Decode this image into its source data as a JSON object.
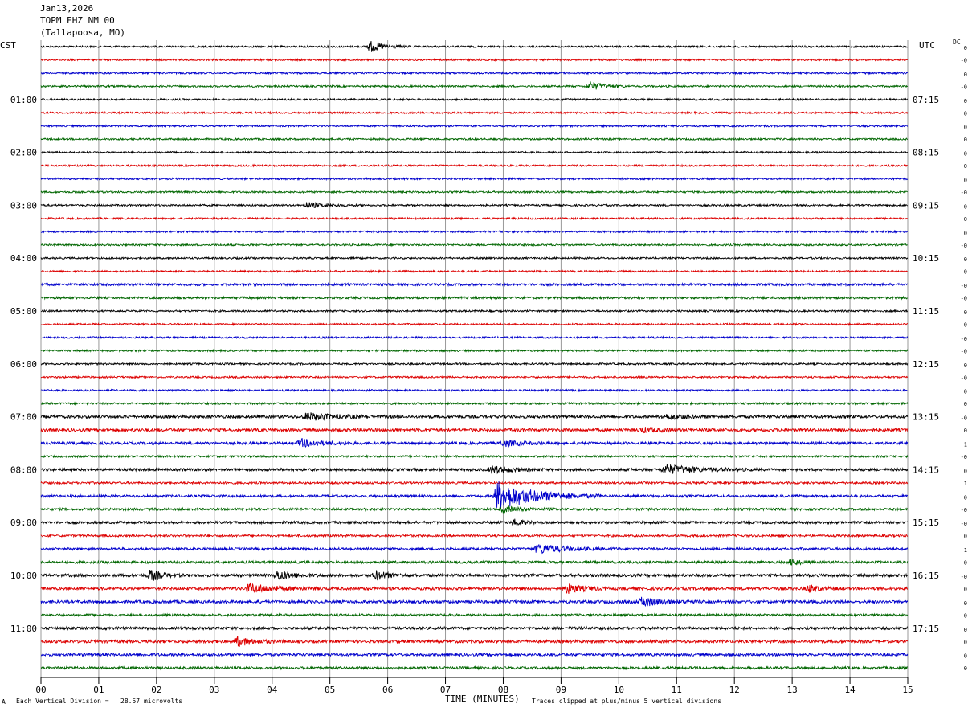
{
  "header": {
    "date": "Jan13,2026",
    "station": "TOPM EHZ NM 00",
    "location": "(Tallapoosa, MO)"
  },
  "left_zone_label": "CST",
  "right_zone_label": "UTC",
  "dc_label": "DC",
  "footer": {
    "scale_text": "Each Vertical Division =   28.57 microvolts",
    "xlabel": "TIME (MINUTES)",
    "clip_text": "Traces clipped at plus/minus 5 vertical divisions",
    "mark": "A"
  },
  "colors": {
    "trace_cycle": [
      "#000000",
      "#dd0000",
      "#0000cc",
      "#006600"
    ],
    "grid": "#999999"
  },
  "chart_data": {
    "type": "line",
    "title": "Jan13,2026 TOPM EHZ NM 00 (Tallapoosa, MO)",
    "xlabel": "TIME (MINUTES)",
    "xlim": [
      0,
      15
    ],
    "x_ticks": [
      "00",
      "01",
      "02",
      "03",
      "04",
      "05",
      "06",
      "07",
      "08",
      "09",
      "10",
      "11",
      "12",
      "13",
      "14",
      "15"
    ],
    "trace_count": 48,
    "left_hour_labels": [
      {
        "trace": 4,
        "label": "01:00"
      },
      {
        "trace": 8,
        "label": "02:00"
      },
      {
        "trace": 12,
        "label": "03:00"
      },
      {
        "trace": 16,
        "label": "04:00"
      },
      {
        "trace": 20,
        "label": "05:00"
      },
      {
        "trace": 24,
        "label": "06:00"
      },
      {
        "trace": 28,
        "label": "07:00"
      },
      {
        "trace": 32,
        "label": "08:00"
      },
      {
        "trace": 36,
        "label": "09:00"
      },
      {
        "trace": 40,
        "label": "10:00"
      },
      {
        "trace": 44,
        "label": "11:00"
      }
    ],
    "right_hour_labels": [
      {
        "trace": 4,
        "label": "07:15"
      },
      {
        "trace": 8,
        "label": "08:15"
      },
      {
        "trace": 12,
        "label": "09:15"
      },
      {
        "trace": 16,
        "label": "10:15"
      },
      {
        "trace": 20,
        "label": "11:15"
      },
      {
        "trace": 24,
        "label": "12:15"
      },
      {
        "trace": 28,
        "label": "13:15"
      },
      {
        "trace": 32,
        "label": "14:15"
      },
      {
        "trace": 36,
        "label": "15:15"
      },
      {
        "trace": 40,
        "label": "16:15"
      },
      {
        "trace": 44,
        "label": "17:15"
      }
    ],
    "dc_offsets": [
      "0",
      "-0",
      "0",
      "-0",
      "0",
      "0",
      "0",
      "0",
      "0",
      "0",
      "0",
      "-0",
      "0",
      "0",
      "0",
      "-0",
      "0",
      "0",
      "-0",
      "-0",
      "0",
      "0",
      "-0",
      "-0",
      "0",
      "-0",
      "0",
      "0",
      "-0",
      "0",
      "1",
      "-0",
      "0",
      "1",
      "0",
      "-0",
      "-0",
      "0",
      "1",
      "0",
      "-0",
      "0",
      "0",
      "-0",
      "0",
      "0",
      "0",
      "0"
    ],
    "noise_levels": [
      1,
      1,
      1,
      1,
      1,
      1,
      1,
      1,
      1,
      1,
      1,
      1,
      1,
      1,
      1,
      1,
      1,
      1,
      1.3,
      1.3,
      1,
      1,
      1,
      1,
      1,
      1,
      1,
      1.1,
      1.6,
      1.7,
      1.5,
      1.1,
      1.5,
      1.2,
      1.4,
      1.3,
      1.4,
      1.2,
      1.4,
      1.4,
      1.6,
      1.6,
      1.6,
      1.3,
      1.5,
      1.6,
      1.5,
      1.4
    ],
    "events": [
      {
        "trace": 0,
        "minute": 5.7,
        "amplitude": 3,
        "duration": 0.7
      },
      {
        "trace": 3,
        "minute": 9.5,
        "amplitude": 2.5,
        "duration": 0.7
      },
      {
        "trace": 12,
        "minute": 4.6,
        "amplitude": 1.5,
        "duration": 1.0
      },
      {
        "trace": 28,
        "minute": 4.6,
        "amplitude": 2,
        "duration": 1.5
      },
      {
        "trace": 28,
        "minute": 10.8,
        "amplitude": 1.5,
        "duration": 1.0
      },
      {
        "trace": 29,
        "minute": 10.4,
        "amplitude": 1.3,
        "duration": 0.7
      },
      {
        "trace": 30,
        "minute": 4.5,
        "amplitude": 2,
        "duration": 1.0
      },
      {
        "trace": 30,
        "minute": 8.0,
        "amplitude": 1.5,
        "duration": 1.0
      },
      {
        "trace": 32,
        "minute": 7.8,
        "amplitude": 1.8,
        "duration": 1.0
      },
      {
        "trace": 32,
        "minute": 10.8,
        "amplitude": 2.5,
        "duration": 1.6
      },
      {
        "trace": 34,
        "minute": 7.9,
        "amplitude": 8,
        "duration": 1.8
      },
      {
        "trace": 35,
        "minute": 8.0,
        "amplitude": 1.5,
        "duration": 1.0
      },
      {
        "trace": 36,
        "minute": 8.2,
        "amplitude": 2,
        "duration": 0.4
      },
      {
        "trace": 38,
        "minute": 8.6,
        "amplitude": 2.5,
        "duration": 1.4
      },
      {
        "trace": 39,
        "minute": 13.0,
        "amplitude": 2,
        "duration": 0.4
      },
      {
        "trace": 40,
        "minute": 1.9,
        "amplitude": 3,
        "duration": 0.6
      },
      {
        "trace": 40,
        "minute": 4.1,
        "amplitude": 2.5,
        "duration": 0.8
      },
      {
        "trace": 40,
        "minute": 5.8,
        "amplitude": 2.5,
        "duration": 0.6
      },
      {
        "trace": 41,
        "minute": 3.6,
        "amplitude": 2.5,
        "duration": 1.3
      },
      {
        "trace": 41,
        "minute": 9.1,
        "amplitude": 2.5,
        "duration": 0.8
      },
      {
        "trace": 41,
        "minute": 13.3,
        "amplitude": 2,
        "duration": 0.5
      },
      {
        "trace": 42,
        "minute": 10.4,
        "amplitude": 2.5,
        "duration": 1.0
      },
      {
        "trace": 45,
        "minute": 3.4,
        "amplitude": 2.5,
        "duration": 0.8
      }
    ]
  }
}
